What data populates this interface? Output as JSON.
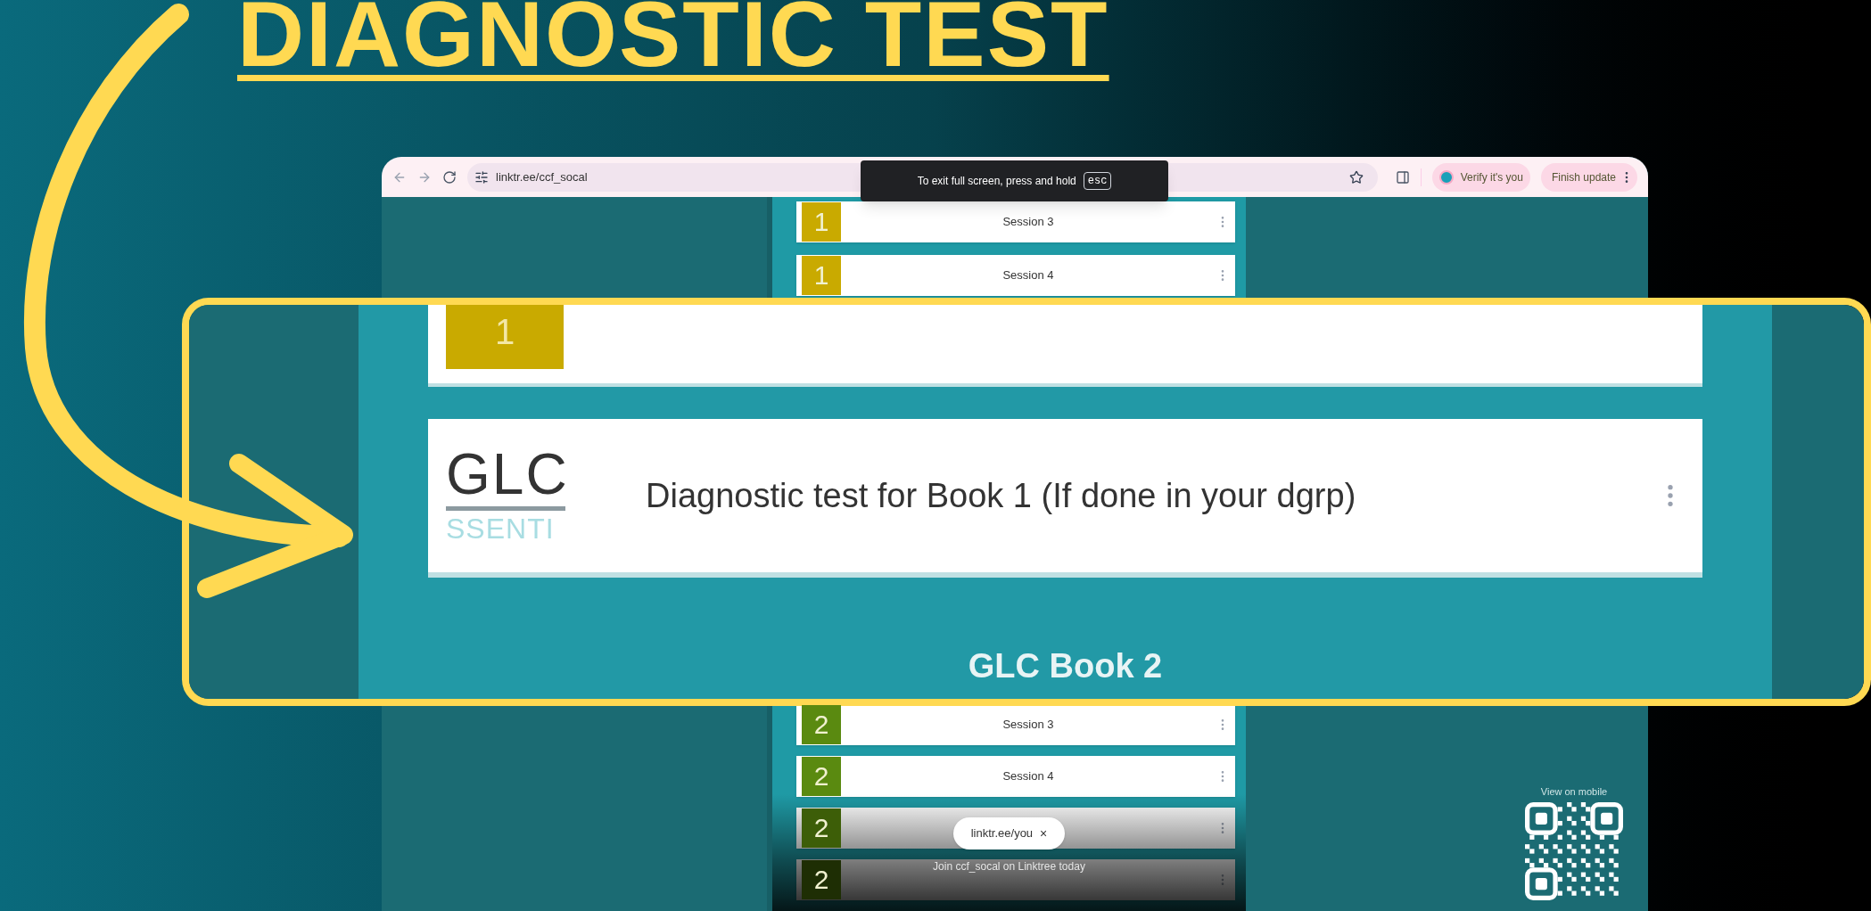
{
  "heading": {
    "text": "DIAGNOSTIC TEST"
  },
  "browser": {
    "url": "linktr.ee/ccf_socal",
    "verify_chip": "Verify it's you",
    "update_chip": "Finish update"
  },
  "toast": {
    "text": "To exit full screen, press and hold",
    "key": "esc"
  },
  "links_top": [
    {
      "title": "Session 3",
      "thumb": "1",
      "color": "#c9aa00"
    },
    {
      "title": "Session 4",
      "thumb": "1",
      "color": "#c9aa00"
    }
  ],
  "callout": {
    "cards": [
      {
        "kind": "session",
        "thumb": "1",
        "color": "#c9aa00"
      },
      {
        "kind": "logo",
        "title": "Diagnostic test for Book 1 (If done in your dgrp)",
        "logo_top": "GLC",
        "logo_bottom": "SSENTI"
      }
    ],
    "section_heading": "GLC Book 2"
  },
  "links_bottom": [
    {
      "title": "Session 3",
      "thumb": "2",
      "color": "#5a8a10"
    },
    {
      "title": "Session 4",
      "thumb": "2",
      "color": "#5a8a10"
    },
    {
      "thumb": "2",
      "color": "#3d5e08"
    },
    {
      "thumb": "2",
      "color": "#1e2e04"
    }
  ],
  "signup_pill": {
    "text": "linktr.ee/you",
    "close": "×"
  },
  "join_text": "Join ccf_socal on Linktree today",
  "qr": {
    "label": "View on mobile"
  }
}
